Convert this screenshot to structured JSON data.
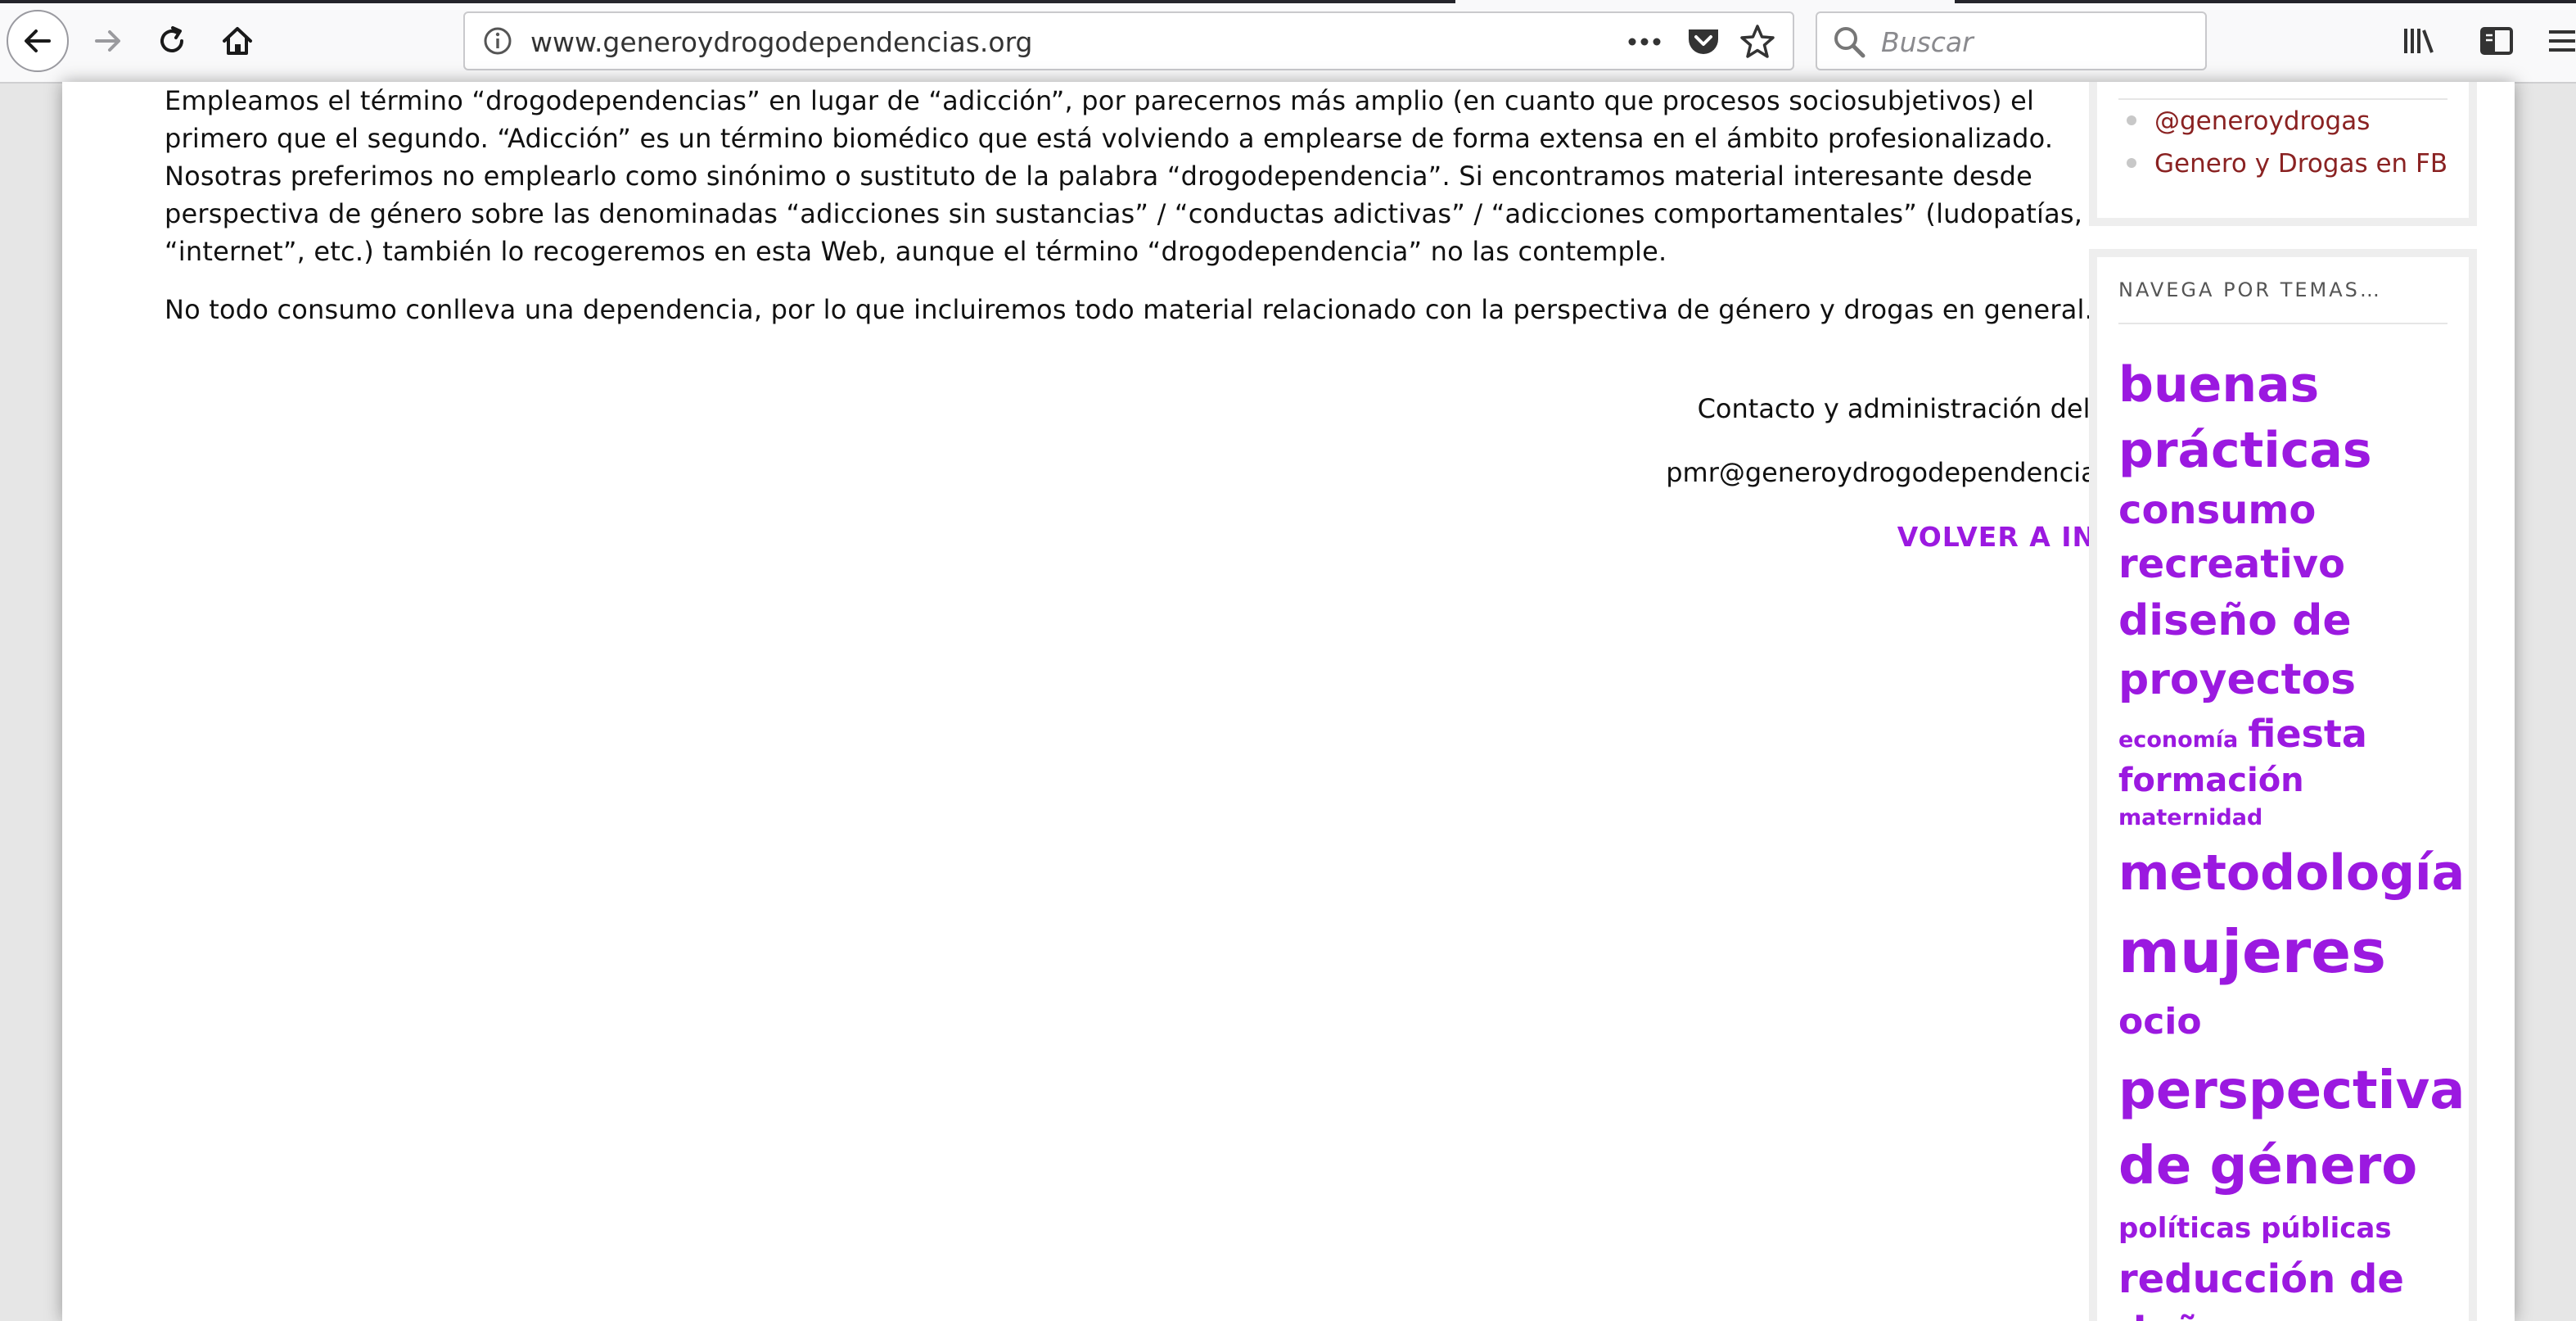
{
  "browser": {
    "url": "www.generoydrogodependencias.org",
    "search_placeholder": "Buscar"
  },
  "content": {
    "paragraph1": "Empleamos el término “drogodependencias” en lugar de “adicción”, por parecernos más amplio (en cuanto que procesos sociosubjetivos) el primero que el segundo. “Adicción” es un término biomédico que está volviendo a emplearse de forma extensa en el ámbito profesionalizado. Nosotras preferimos no emplearlo como sinónimo o sustituto de la palabra “drogodependencia”. Si encontramos material interesante desde perspectiva de género sobre las denominadas  “adicciones sin sustancias” / “conductas adictivas” / “adicciones comportamentales” (ludopatías, “internet”, etc.) también lo recogeremos en esta Web, aunque el término “drogodependencia” no las contemple.",
    "paragraph2": "No todo consumo conlleva una dependencia, por lo que incluiremos todo material relacionado con la perspectiva de género y drogas en general.",
    "contact_label": "Contacto y administración del sitio:",
    "contact_email": "pmr@generoydrogodependencias.org",
    "back_home": "VOLVER A INICIO"
  },
  "sidebar": {
    "links": [
      {
        "label": "@generoydrogas"
      },
      {
        "label": "Genero y Drogas en FB"
      }
    ],
    "tags_title": "NAVEGA POR TEMAS…",
    "tags": [
      {
        "label": "buenas",
        "size": 60
      },
      {
        "label": "prácticas",
        "size": 60
      },
      {
        "label": "consumo",
        "size": 48
      },
      {
        "label": "recreativo",
        "size": 48
      },
      {
        "label": "diseño de",
        "size": 52
      },
      {
        "label": "proyectos",
        "size": 52
      },
      {
        "label": "economía",
        "size": 27
      },
      {
        "label": "fiesta",
        "size": 46
      },
      {
        "label": "formación",
        "size": 40
      },
      {
        "label": "maternidad",
        "size": 27
      },
      {
        "label": "metodología",
        "size": 60
      },
      {
        "label": "mujeres",
        "size": 72
      },
      {
        "label": "ocio",
        "size": 44
      },
      {
        "label": "perspectiva",
        "size": 64
      },
      {
        "label": "de género",
        "size": 64
      },
      {
        "label": "políticas públicas",
        "size": 34
      },
      {
        "label": "reducción de",
        "size": 48
      },
      {
        "label": "daños",
        "size": 48
      }
    ],
    "accent_color": "#9b19e0",
    "link_color": "#8a2222"
  }
}
